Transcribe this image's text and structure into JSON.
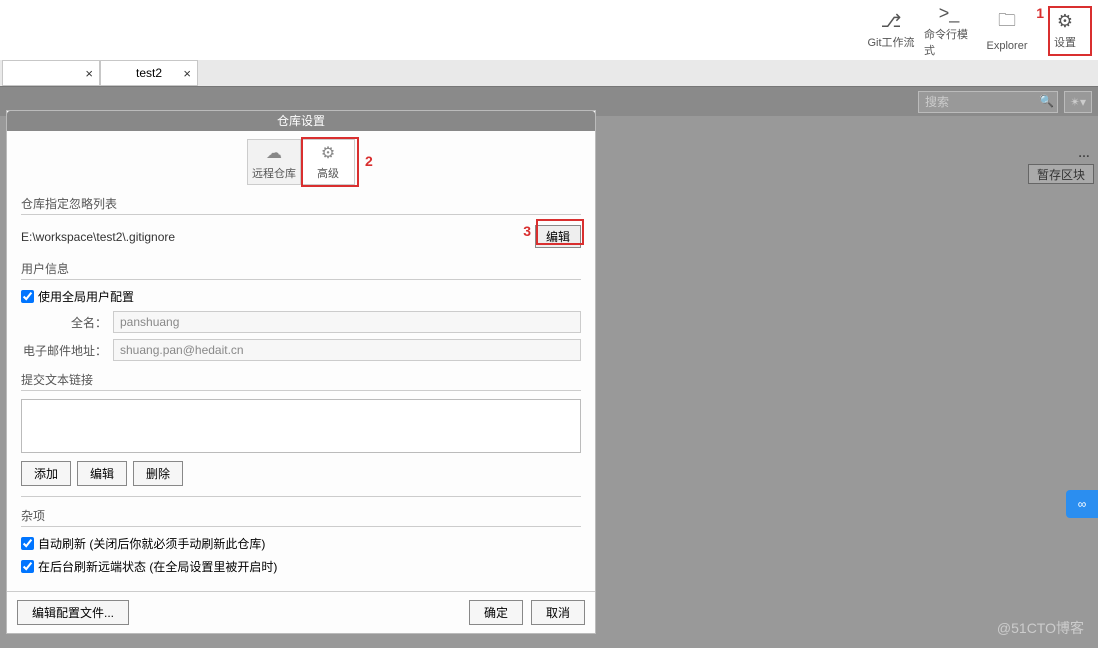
{
  "toolbar": {
    "items": [
      {
        "label": "Git工作流",
        "icon": "⎇"
      },
      {
        "label": "命令行模式",
        "icon": ">_"
      },
      {
        "label": "Explorer",
        "icon": "🗀"
      },
      {
        "label": "设置",
        "icon": "⚙"
      }
    ]
  },
  "annotations": {
    "a1": "1",
    "a2": "2",
    "a3": "3"
  },
  "tabs": [
    {
      "label": ""
    },
    {
      "label": "test2"
    }
  ],
  "search": {
    "placeholder": "搜索"
  },
  "stash_button": "暂存区块",
  "dialog": {
    "title": "仓库设置",
    "tabs": [
      {
        "label": "远程仓库"
      },
      {
        "label": "高级"
      }
    ],
    "ignore_section_title": "仓库指定忽略列表",
    "ignore_path": "E:\\workspace\\test2\\.gitignore",
    "edit_btn": "编辑",
    "user_section_title": "用户信息",
    "use_global_label": "使用全局用户配置",
    "fullname_label": "全名：",
    "fullname_value": "panshuang",
    "email_label": "电子邮件地址：",
    "email_value": "shuang.pan@hedait.cn",
    "text_links_title": "提交文本链接",
    "add_btn": "添加",
    "edit2_btn": "编辑",
    "delete_btn": "删除",
    "misc_title": "杂项",
    "auto_refresh_label": "自动刷新 (关闭后你就必须手动刷新此仓库)",
    "bg_refresh_label": "在后台刷新远端状态 (在全局设置里被开启时)",
    "edit_config_btn": "编辑配置文件...",
    "ok_btn": "确定",
    "cancel_btn": "取消"
  },
  "watermark": "@51CTO博客"
}
